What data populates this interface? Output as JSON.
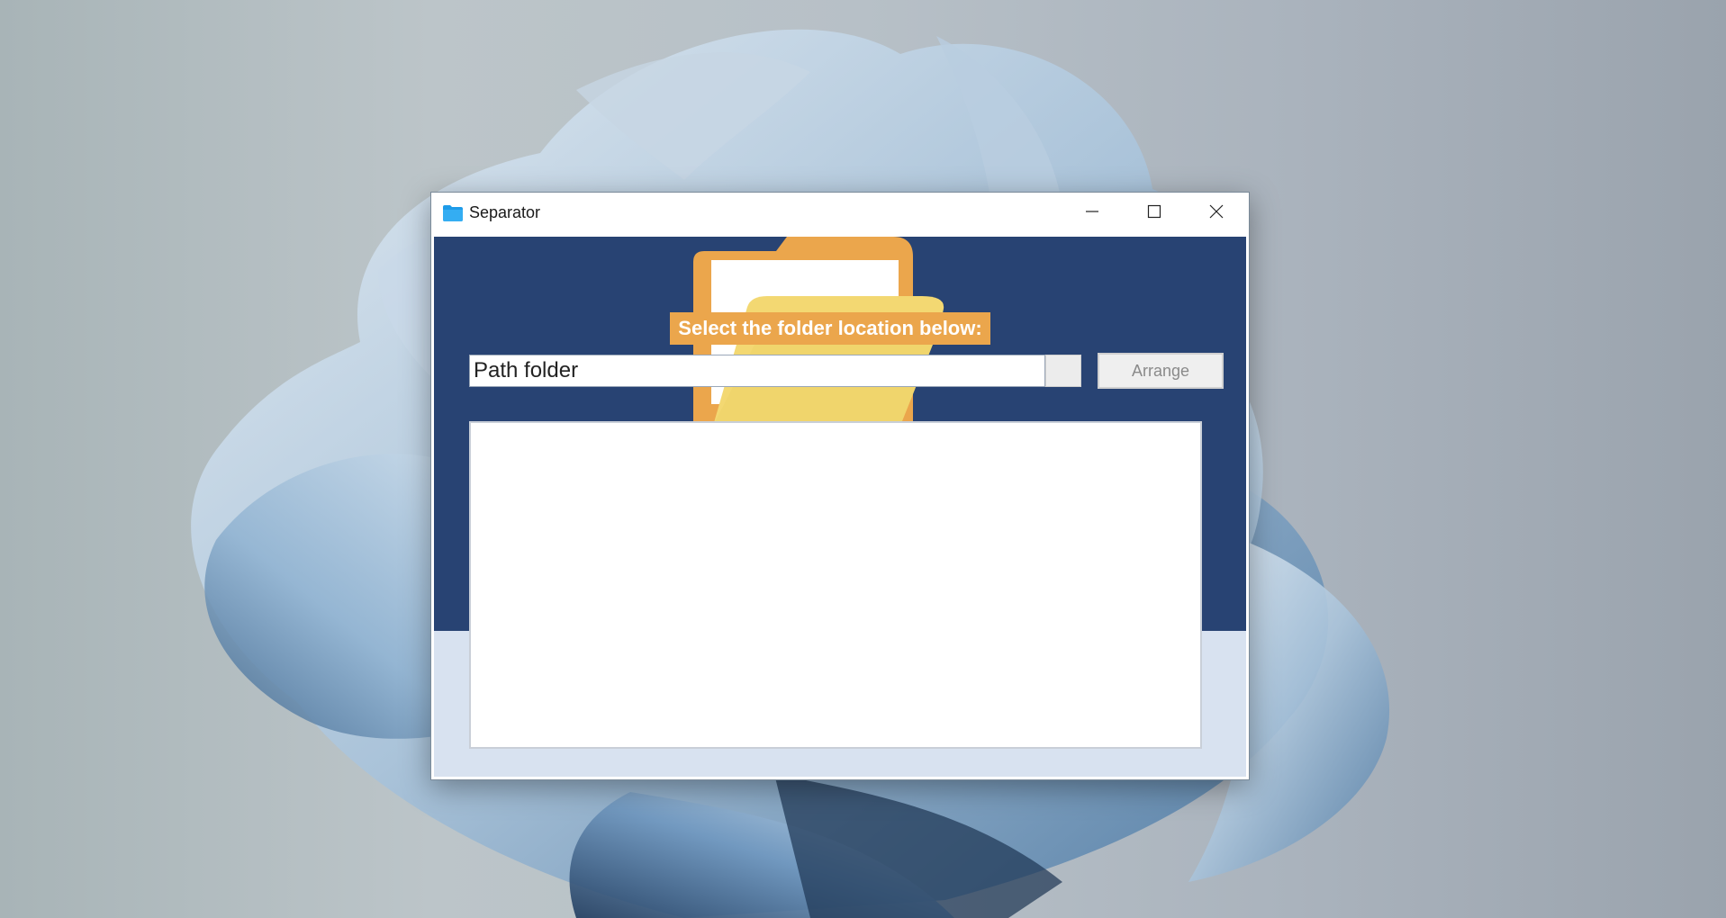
{
  "window": {
    "title": "Separator",
    "icon": "folder-icon",
    "controls": {
      "minimize": "minimize-icon",
      "maximize": "maximize-icon",
      "close": "close-icon"
    }
  },
  "form": {
    "heading": "Select the folder location below:",
    "path_value": "Path folder",
    "arrange_label": "Arrange",
    "output_text": ""
  },
  "colors": {
    "banner": "#284373",
    "heading_bg": "#eba64c",
    "client_bg": "#d8e2f0",
    "folder_back": "#eba64c",
    "folder_front": "#f3d872",
    "title_icon": "#1e9be8"
  }
}
